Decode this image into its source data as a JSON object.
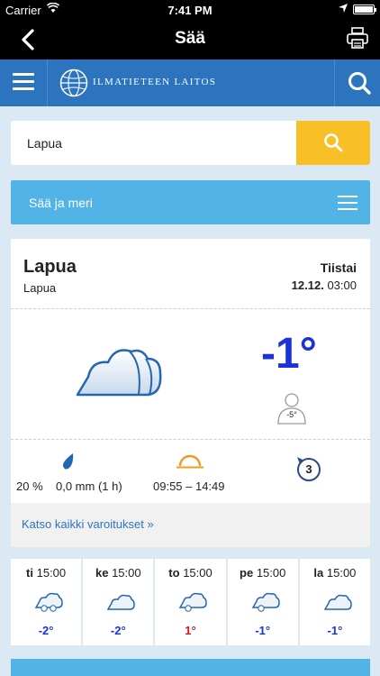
{
  "status_bar": {
    "carrier": "Carrier",
    "time": "7:41 PM"
  },
  "nav": {
    "title": "Sää",
    "back_icon": "chevron-left-icon",
    "print_icon": "printer-icon"
  },
  "header": {
    "brand": "ILMATIETEEN LAITOS",
    "menu_icon": "hamburger-icon",
    "search_icon": "search-icon",
    "color": "#2d74bf"
  },
  "search": {
    "value": "Lapua",
    "button_color": "#f8bf27"
  },
  "category": {
    "label": "Sää ja meri"
  },
  "current": {
    "location": "Lapua",
    "sublocation": "Lapua",
    "weekday": "Tiistai",
    "date": "12.12.",
    "time": "03:00",
    "temperature": "-1°",
    "feels_like": "-5°",
    "precip_probability": "20 %",
    "precip_amount": "0,0 mm (1 h)",
    "sun": "09:55 – 14:49",
    "wind": "3",
    "warnings_link": "Katso kaikki varoitukset »"
  },
  "forecast": [
    {
      "day": "ti",
      "time": "15:00",
      "temp": "-2°",
      "temp_color": "#1a33d8",
      "icon": "snow-cloud-icon"
    },
    {
      "day": "ke",
      "time": "15:00",
      "temp": "-2°",
      "temp_color": "#1a33d8",
      "icon": "cloud-icon"
    },
    {
      "day": "to",
      "time": "15:00",
      "temp": "1°",
      "temp_color": "#d01818",
      "icon": "snow-cloud-icon"
    },
    {
      "day": "pe",
      "time": "15:00",
      "temp": "-1°",
      "temp_color": "#1a33d8",
      "icon": "snow-cloud-icon"
    },
    {
      "day": "la",
      "time": "15:00",
      "temp": "-1°",
      "temp_color": "#1a33d8",
      "icon": "cloud-icon"
    }
  ]
}
